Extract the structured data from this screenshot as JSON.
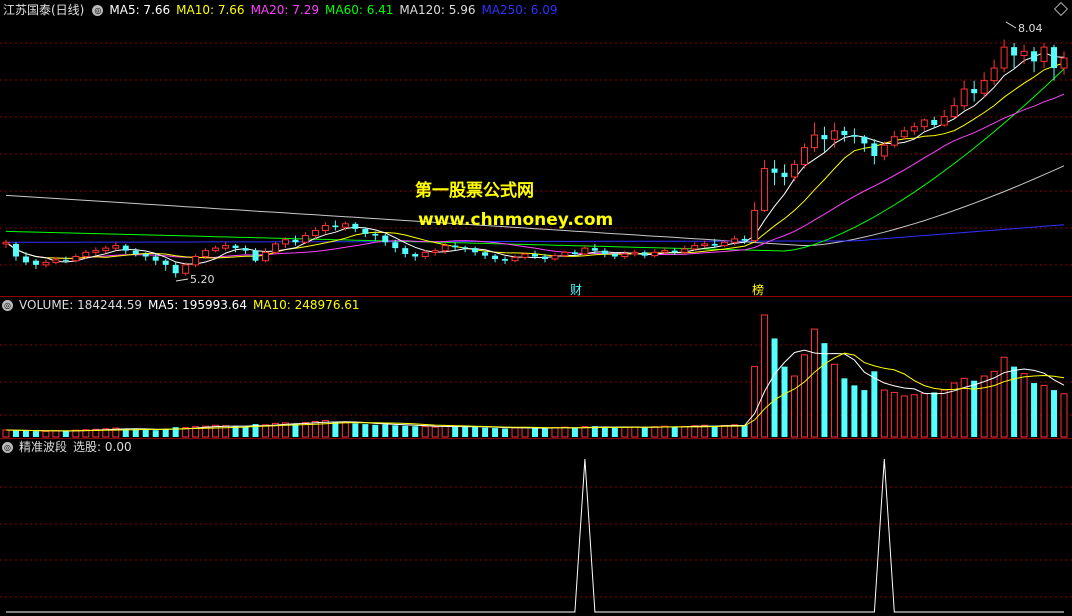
{
  "main_pane": {
    "title": "江苏国泰(日线)",
    "indicators": [
      {
        "label": "MA5: 7.66",
        "color": "#ffffff"
      },
      {
        "label": "MA10: 7.66",
        "color": "#ffff00"
      },
      {
        "label": "MA20: 7.29",
        "color": "#ff40ff"
      },
      {
        "label": "MA60: 6.41",
        "color": "#00ff00"
      },
      {
        "label": "MA120: 5.96",
        "color": "#dddddd"
      },
      {
        "label": "MA250: 6.09",
        "color": "#3030ff"
      }
    ],
    "high_label": "8.04",
    "low_label": "5.20",
    "marker_cai": "财",
    "marker_bang": "榜"
  },
  "watermark": {
    "line1": "第一股票公式网",
    "line2": "www.chnmoney.com"
  },
  "volume_pane": {
    "title": "VOLUME: 184244.59",
    "ma5": "MA5: 195993.64",
    "ma10": "MA10: 248976.61"
  },
  "signal_pane": {
    "title": "精准波段",
    "value": "选股: 0.00"
  },
  "colors": {
    "up": "#ff3232",
    "down": "#54ffff",
    "grid": "#8b0000"
  },
  "chart_data": {
    "type": "candlestick",
    "price_range": [
      5.2,
      8.04
    ],
    "candles": [
      [
        5.6,
        5.62,
        5.55,
        5.65
      ],
      [
        5.6,
        5.45,
        5.4,
        5.62
      ],
      [
        5.45,
        5.38,
        5.35,
        5.5
      ],
      [
        5.4,
        5.35,
        5.3,
        5.42
      ],
      [
        5.35,
        5.38,
        5.32,
        5.41
      ],
      [
        5.38,
        5.41,
        5.36,
        5.44
      ],
      [
        5.41,
        5.4,
        5.37,
        5.45
      ],
      [
        5.4,
        5.45,
        5.38,
        5.48
      ],
      [
        5.45,
        5.5,
        5.42,
        5.53
      ],
      [
        5.5,
        5.52,
        5.46,
        5.56
      ],
      [
        5.52,
        5.55,
        5.49,
        5.58
      ],
      [
        5.55,
        5.58,
        5.52,
        5.62
      ],
      [
        5.58,
        5.52,
        5.48,
        5.6
      ],
      [
        5.52,
        5.48,
        5.45,
        5.55
      ],
      [
        5.48,
        5.45,
        5.4,
        5.5
      ],
      [
        5.45,
        5.4,
        5.35,
        5.48
      ],
      [
        5.4,
        5.35,
        5.28,
        5.42
      ],
      [
        5.35,
        5.25,
        5.2,
        5.38
      ],
      [
        5.25,
        5.35,
        5.22,
        5.38
      ],
      [
        5.35,
        5.45,
        5.32,
        5.48
      ],
      [
        5.45,
        5.52,
        5.42,
        5.55
      ],
      [
        5.52,
        5.55,
        5.5,
        5.58
      ],
      [
        5.55,
        5.58,
        5.52,
        5.62
      ],
      [
        5.58,
        5.55,
        5.5,
        5.6
      ],
      [
        5.55,
        5.52,
        5.48,
        5.58
      ],
      [
        5.52,
        5.4,
        5.38,
        5.55
      ],
      [
        5.4,
        5.5,
        5.38,
        5.55
      ],
      [
        5.5,
        5.6,
        5.48,
        5.62
      ],
      [
        5.6,
        5.65,
        5.55,
        5.68
      ],
      [
        5.65,
        5.62,
        5.58,
        5.7
      ],
      [
        5.62,
        5.7,
        5.6,
        5.74
      ],
      [
        5.7,
        5.76,
        5.66,
        5.8
      ],
      [
        5.76,
        5.82,
        5.72,
        5.86
      ],
      [
        5.82,
        5.8,
        5.76,
        5.88
      ],
      [
        5.8,
        5.84,
        5.76,
        5.87
      ],
      [
        5.84,
        5.78,
        5.74,
        5.86
      ],
      [
        5.78,
        5.72,
        5.68,
        5.8
      ],
      [
        5.72,
        5.7,
        5.64,
        5.75
      ],
      [
        5.7,
        5.62,
        5.58,
        5.72
      ],
      [
        5.62,
        5.55,
        5.5,
        5.65
      ],
      [
        5.55,
        5.48,
        5.44,
        5.58
      ],
      [
        5.48,
        5.45,
        5.4,
        5.5
      ],
      [
        5.45,
        5.5,
        5.42,
        5.53
      ],
      [
        5.5,
        5.52,
        5.46,
        5.55
      ],
      [
        5.52,
        5.58,
        5.48,
        5.62
      ],
      [
        5.58,
        5.56,
        5.52,
        5.62
      ],
      [
        5.56,
        5.55,
        5.5,
        5.58
      ],
      [
        5.55,
        5.5,
        5.46,
        5.57
      ],
      [
        5.5,
        5.46,
        5.42,
        5.52
      ],
      [
        5.46,
        5.42,
        5.38,
        5.48
      ],
      [
        5.42,
        5.4,
        5.36,
        5.45
      ],
      [
        5.4,
        5.44,
        5.38,
        5.47
      ],
      [
        5.44,
        5.48,
        5.41,
        5.5
      ],
      [
        5.48,
        5.45,
        5.42,
        5.52
      ],
      [
        5.45,
        5.42,
        5.38,
        5.48
      ],
      [
        5.42,
        5.46,
        5.4,
        5.49
      ],
      [
        5.46,
        5.5,
        5.44,
        5.52
      ],
      [
        5.5,
        5.48,
        5.45,
        5.53
      ],
      [
        5.48,
        5.55,
        5.46,
        5.58
      ],
      [
        5.55,
        5.52,
        5.48,
        5.6
      ],
      [
        5.52,
        5.48,
        5.44,
        5.55
      ],
      [
        5.48,
        5.45,
        5.42,
        5.5
      ],
      [
        5.45,
        5.48,
        5.42,
        5.52
      ],
      [
        5.48,
        5.5,
        5.45,
        5.53
      ],
      [
        5.5,
        5.46,
        5.43,
        5.52
      ],
      [
        5.46,
        5.5,
        5.44,
        5.54
      ],
      [
        5.5,
        5.52,
        5.48,
        5.56
      ],
      [
        5.52,
        5.5,
        5.47,
        5.55
      ],
      [
        5.5,
        5.54,
        5.48,
        5.58
      ],
      [
        5.54,
        5.58,
        5.52,
        5.62
      ],
      [
        5.58,
        5.6,
        5.55,
        5.64
      ],
      [
        5.6,
        5.58,
        5.55,
        5.66
      ],
      [
        5.58,
        5.62,
        5.56,
        5.65
      ],
      [
        5.62,
        5.66,
        5.58,
        5.7
      ],
      [
        5.66,
        5.64,
        5.6,
        5.7
      ],
      [
        5.64,
        6.0,
        5.62,
        6.1
      ],
      [
        6.0,
        6.5,
        5.98,
        6.6
      ],
      [
        6.5,
        6.45,
        6.3,
        6.6
      ],
      [
        6.45,
        6.4,
        6.3,
        6.55
      ],
      [
        6.4,
        6.55,
        6.35,
        6.6
      ],
      [
        6.55,
        6.75,
        6.5,
        6.8
      ],
      [
        6.75,
        6.9,
        6.7,
        7.05
      ],
      [
        6.9,
        6.85,
        6.7,
        7.0
      ],
      [
        6.85,
        6.95,
        6.75,
        7.05
      ],
      [
        6.95,
        6.9,
        6.82,
        7.0
      ],
      [
        6.9,
        6.88,
        6.8,
        6.98
      ],
      [
        6.88,
        6.8,
        6.7,
        6.9
      ],
      [
        6.8,
        6.65,
        6.55,
        6.85
      ],
      [
        6.65,
        6.78,
        6.6,
        6.82
      ],
      [
        6.78,
        6.88,
        6.75,
        6.95
      ],
      [
        6.88,
        6.95,
        6.85,
        7.0
      ],
      [
        6.95,
        7.0,
        6.9,
        7.05
      ],
      [
        7.0,
        7.08,
        6.95,
        7.1
      ],
      [
        7.08,
        7.02,
        6.98,
        7.12
      ],
      [
        7.02,
        7.12,
        7.0,
        7.2
      ],
      [
        7.12,
        7.25,
        7.1,
        7.35
      ],
      [
        7.25,
        7.45,
        7.2,
        7.55
      ],
      [
        7.45,
        7.4,
        7.3,
        7.55
      ],
      [
        7.4,
        7.55,
        7.35,
        7.65
      ],
      [
        7.55,
        7.7,
        7.5,
        7.8
      ],
      [
        7.7,
        7.95,
        7.65,
        8.04
      ],
      [
        7.95,
        7.85,
        7.7,
        8.0
      ],
      [
        7.85,
        7.9,
        7.75,
        7.98
      ],
      [
        7.9,
        7.78,
        7.65,
        7.95
      ],
      [
        7.78,
        7.95,
        7.7,
        8.0
      ],
      [
        7.95,
        7.7,
        7.55,
        7.98
      ],
      [
        7.7,
        7.82,
        7.62,
        7.9
      ]
    ],
    "volume_range": [
      0,
      520000
    ],
    "volumes": [
      30000,
      28000,
      26000,
      25000,
      24000,
      27000,
      26000,
      29000,
      31000,
      33000,
      35000,
      38000,
      36000,
      33000,
      30000,
      29000,
      35000,
      42000,
      40000,
      44000,
      46000,
      50000,
      48000,
      45000,
      43000,
      55000,
      52000,
      58000,
      60000,
      56000,
      62000,
      66000,
      70000,
      65000,
      60000,
      58000,
      55000,
      52000,
      54000,
      50000,
      48000,
      46000,
      44000,
      42000,
      45000,
      47000,
      44000,
      42000,
      40000,
      38000,
      36000,
      39000,
      41000,
      38000,
      36000,
      40000,
      42000,
      39000,
      44000,
      46000,
      42000,
      40000,
      41000,
      43000,
      40000,
      44000,
      46000,
      43000,
      45000,
      48000,
      50000,
      47000,
      49000,
      52000,
      50000,
      300000,
      520000,
      420000,
      300000,
      260000,
      350000,
      460000,
      400000,
      310000,
      250000,
      220000,
      200000,
      280000,
      200000,
      190000,
      175000,
      180000,
      185000,
      190000,
      200000,
      230000,
      250000,
      240000,
      260000,
      280000,
      340000,
      300000,
      270000,
      230000,
      220000,
      200000,
      184244
    ],
    "signal_spikes": [
      {
        "index": 58,
        "value": 1
      },
      {
        "index": 88,
        "value": 1
      }
    ]
  }
}
